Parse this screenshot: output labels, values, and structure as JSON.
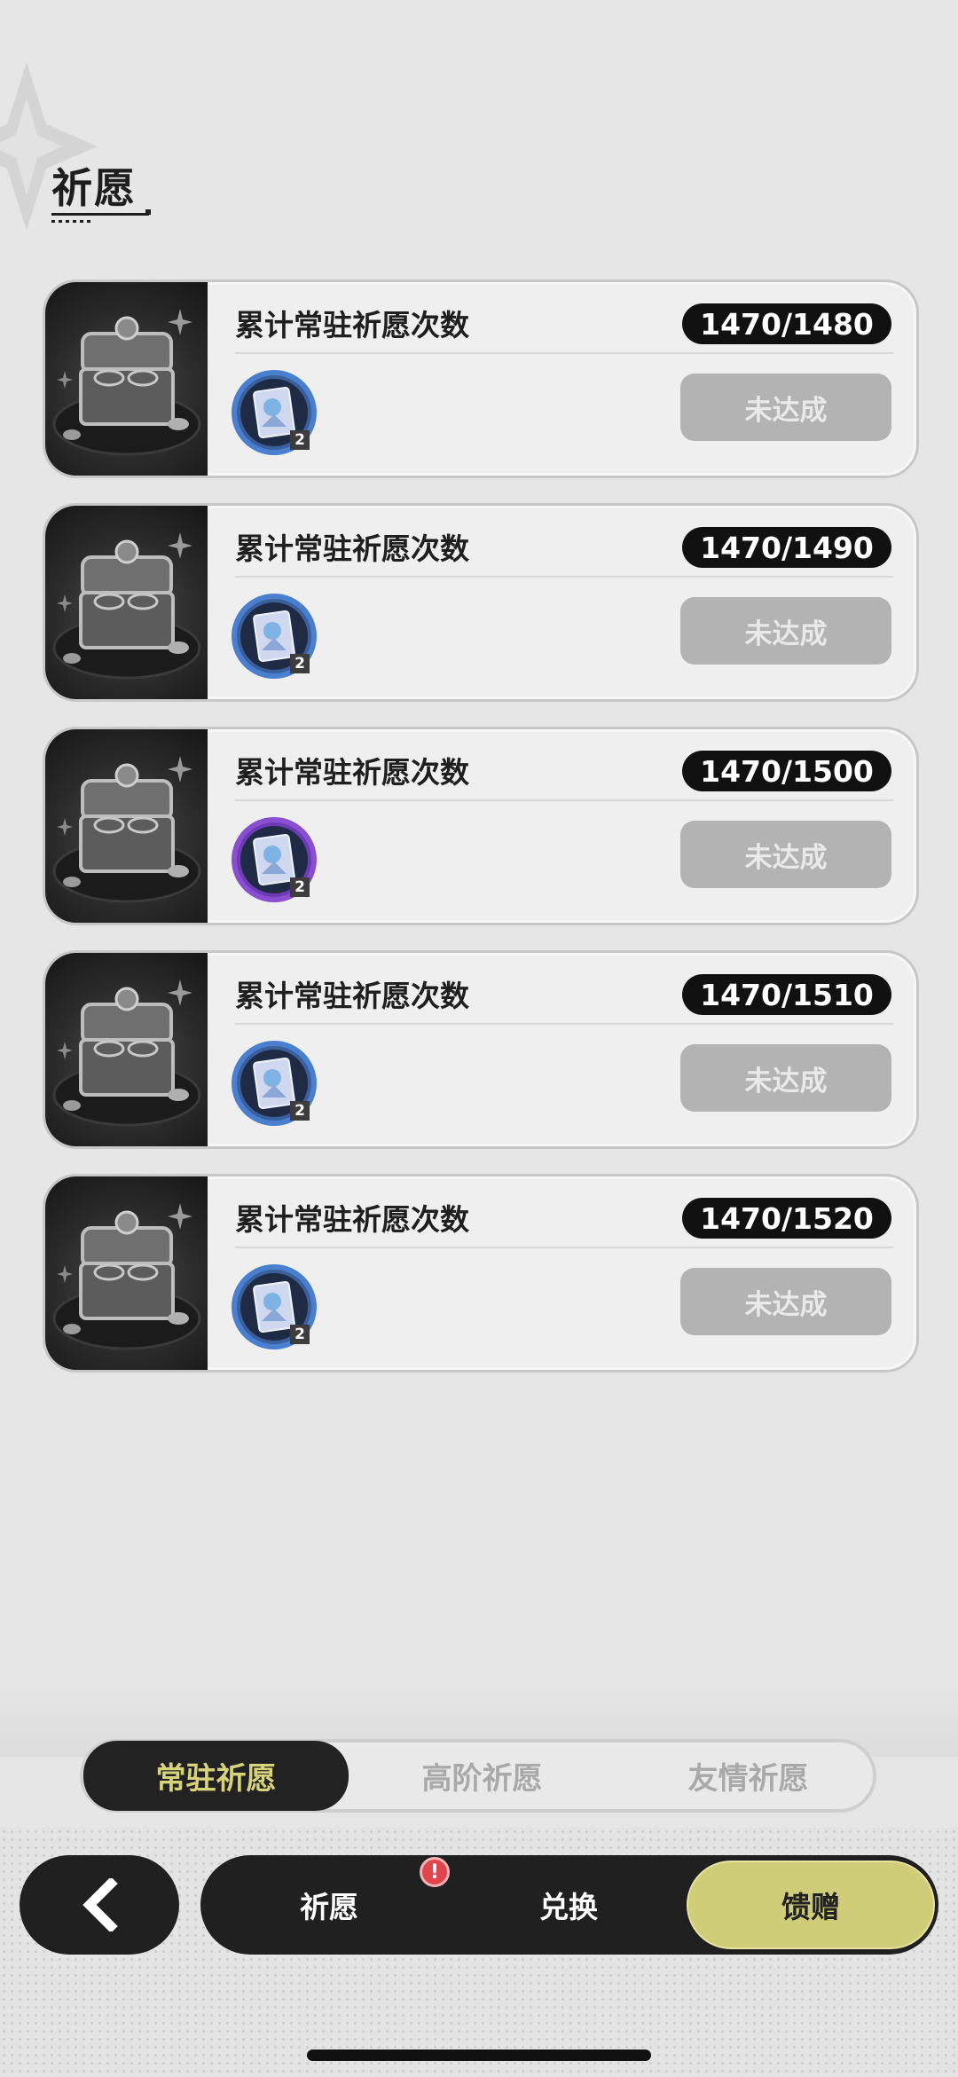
{
  "header": {
    "title": "祈愿"
  },
  "rewards": {
    "items": [
      {
        "label": "累计常驻祈愿次数",
        "progress": "1470/1480",
        "status": "未达成",
        "reward_qty": "2",
        "reward_rarity": "blue"
      },
      {
        "label": "累计常驻祈愿次数",
        "progress": "1470/1490",
        "status": "未达成",
        "reward_qty": "2",
        "reward_rarity": "blue"
      },
      {
        "label": "累计常驻祈愿次数",
        "progress": "1470/1500",
        "status": "未达成",
        "reward_qty": "2",
        "reward_rarity": "purple"
      },
      {
        "label": "累计常驻祈愿次数",
        "progress": "1470/1510",
        "status": "未达成",
        "reward_qty": "2",
        "reward_rarity": "blue"
      },
      {
        "label": "累计常驻祈愿次数",
        "progress": "1470/1520",
        "status": "未达成",
        "reward_qty": "2",
        "reward_rarity": "blue"
      }
    ]
  },
  "tabs": {
    "active": 0,
    "items": [
      {
        "label": "常驻祈愿"
      },
      {
        "label": "高阶祈愿"
      },
      {
        "label": "友情祈愿"
      }
    ]
  },
  "nav": {
    "back_icon": "chevron-left-icon",
    "alert_mark": "!",
    "items": [
      {
        "label": "祈愿"
      },
      {
        "label": "兑换"
      },
      {
        "label": "馈赠"
      }
    ],
    "active": 2
  },
  "colors": {
    "active_tab_text": "#d7d37a",
    "active_nav_bg": "#cfcd77",
    "alert": "#e0454d",
    "rarity_blue": "#4a7fd0",
    "rarity_purple": "#8a4fd1"
  }
}
